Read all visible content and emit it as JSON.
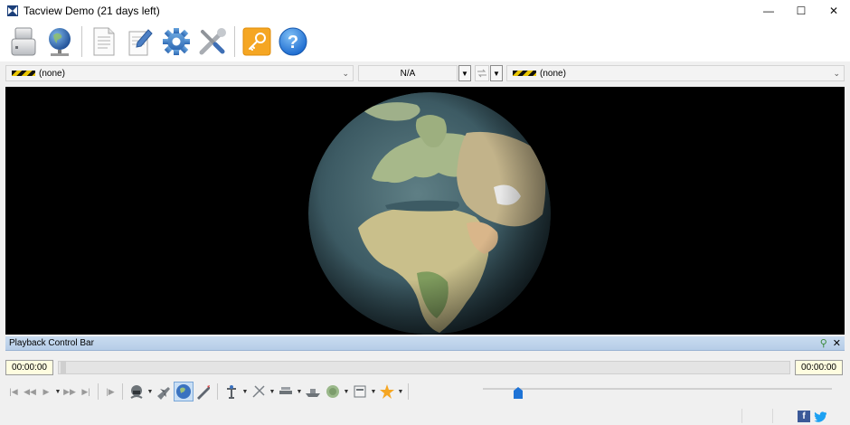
{
  "window": {
    "title": "Tacview Demo (21 days left)",
    "controls": {
      "minimize": "—",
      "maximize": "☐",
      "close": "✕"
    }
  },
  "toolbar": {
    "buttons": [
      {
        "name": "open-file-button",
        "icon": "usb-drive-icon"
      },
      {
        "name": "connect-button",
        "icon": "globe-network-icon"
      },
      {
        "name": "flight-log-button",
        "icon": "document-icon"
      },
      {
        "name": "notepad-button",
        "icon": "notepad-pen-icon"
      },
      {
        "name": "settings-button",
        "icon": "gear-icon"
      },
      {
        "name": "add-ons-button",
        "icon": "tools-icon"
      },
      {
        "name": "license-button",
        "icon": "key-icon"
      },
      {
        "name": "help-button",
        "icon": "help-icon"
      }
    ]
  },
  "selectors": {
    "primary_object": "(none)",
    "camera_mode": "N/A",
    "secondary_object": "(none)"
  },
  "playback": {
    "header": "Playback Control Bar",
    "start_time": "00:00:00",
    "end_time": "00:00:00",
    "timeline_position": 0.0,
    "speed_position": 0.1
  },
  "colors": {
    "accent": "#3a7bd5",
    "panel_header": "#c9dcf0",
    "view_background": "#000000",
    "time_box": "#fffde0"
  }
}
